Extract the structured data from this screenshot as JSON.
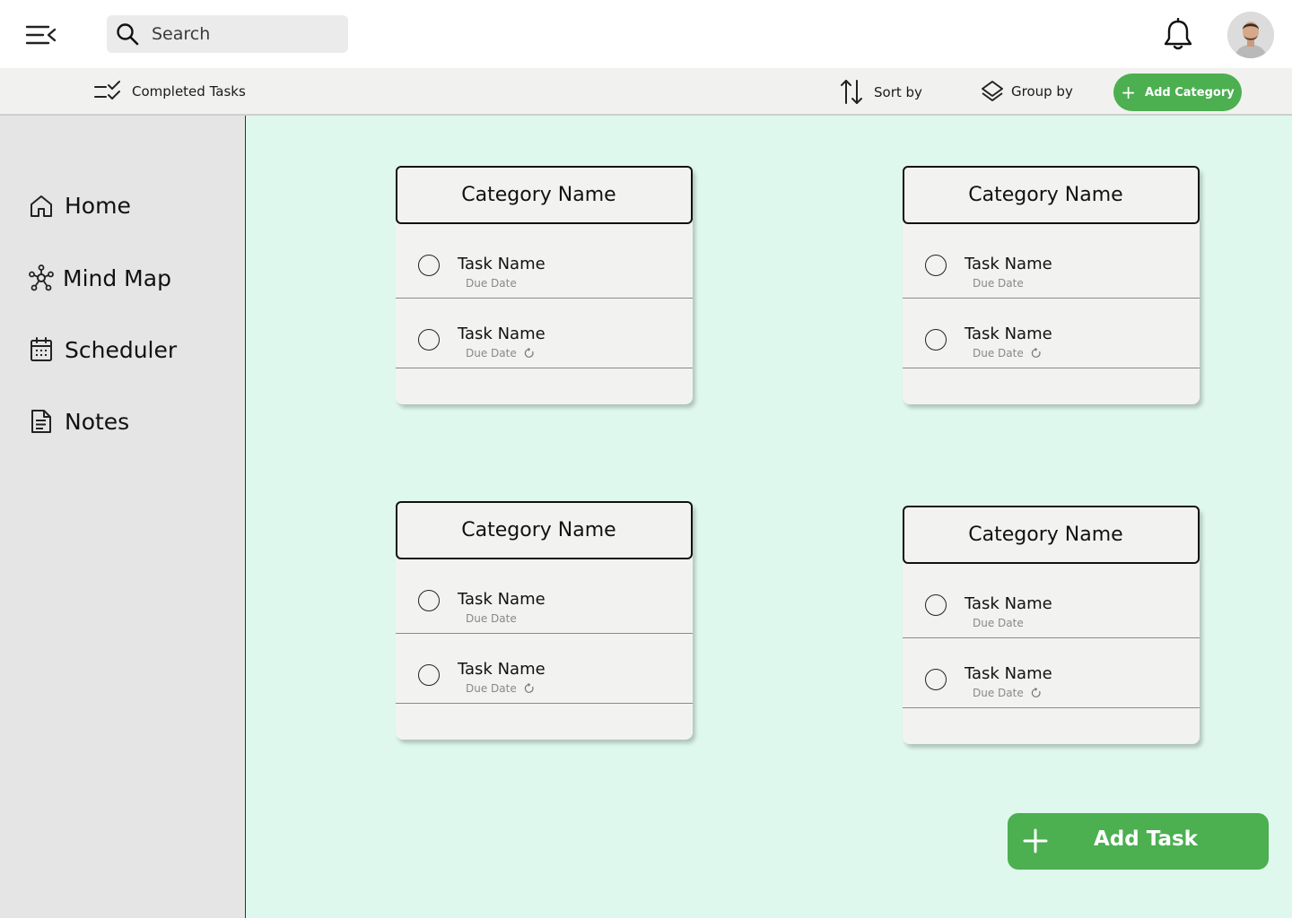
{
  "topbar": {
    "search_placeholder": "Search"
  },
  "toolbar": {
    "completed_label": "Completed Tasks",
    "sort_label": "Sort by",
    "group_label": "Group by",
    "add_category_label": "Add Category"
  },
  "sidebar": {
    "items": [
      {
        "label": "Home",
        "icon": "home-icon"
      },
      {
        "label": "Mind Map",
        "icon": "mind-map-icon"
      },
      {
        "label": "Scheduler",
        "icon": "calendar-icon"
      },
      {
        "label": "Notes",
        "icon": "notes-icon"
      }
    ]
  },
  "categories": [
    {
      "name": "Category Name",
      "tasks": [
        {
          "name": "Task Name",
          "due": "Due Date",
          "repeat": false
        },
        {
          "name": "Task Name",
          "due": "Due Date",
          "repeat": true
        }
      ]
    },
    {
      "name": "Category Name",
      "tasks": [
        {
          "name": "Task Name",
          "due": "Due Date",
          "repeat": false
        },
        {
          "name": "Task Name",
          "due": "Due Date",
          "repeat": true
        }
      ]
    },
    {
      "name": "Category Name",
      "tasks": [
        {
          "name": "Task Name",
          "due": "Due Date",
          "repeat": false
        },
        {
          "name": "Task Name",
          "due": "Due Date",
          "repeat": true
        }
      ]
    },
    {
      "name": "Category Name",
      "tasks": [
        {
          "name": "Task Name",
          "due": "Due Date",
          "repeat": false
        },
        {
          "name": "Task Name",
          "due": "Due Date",
          "repeat": true
        }
      ]
    }
  ],
  "add_task_label": "Add Task",
  "colors": {
    "accent": "#4caf50",
    "main_bg": "#dff8ee",
    "sidebar_bg": "#e5e5e5",
    "card_bg": "#f2f3f1"
  }
}
